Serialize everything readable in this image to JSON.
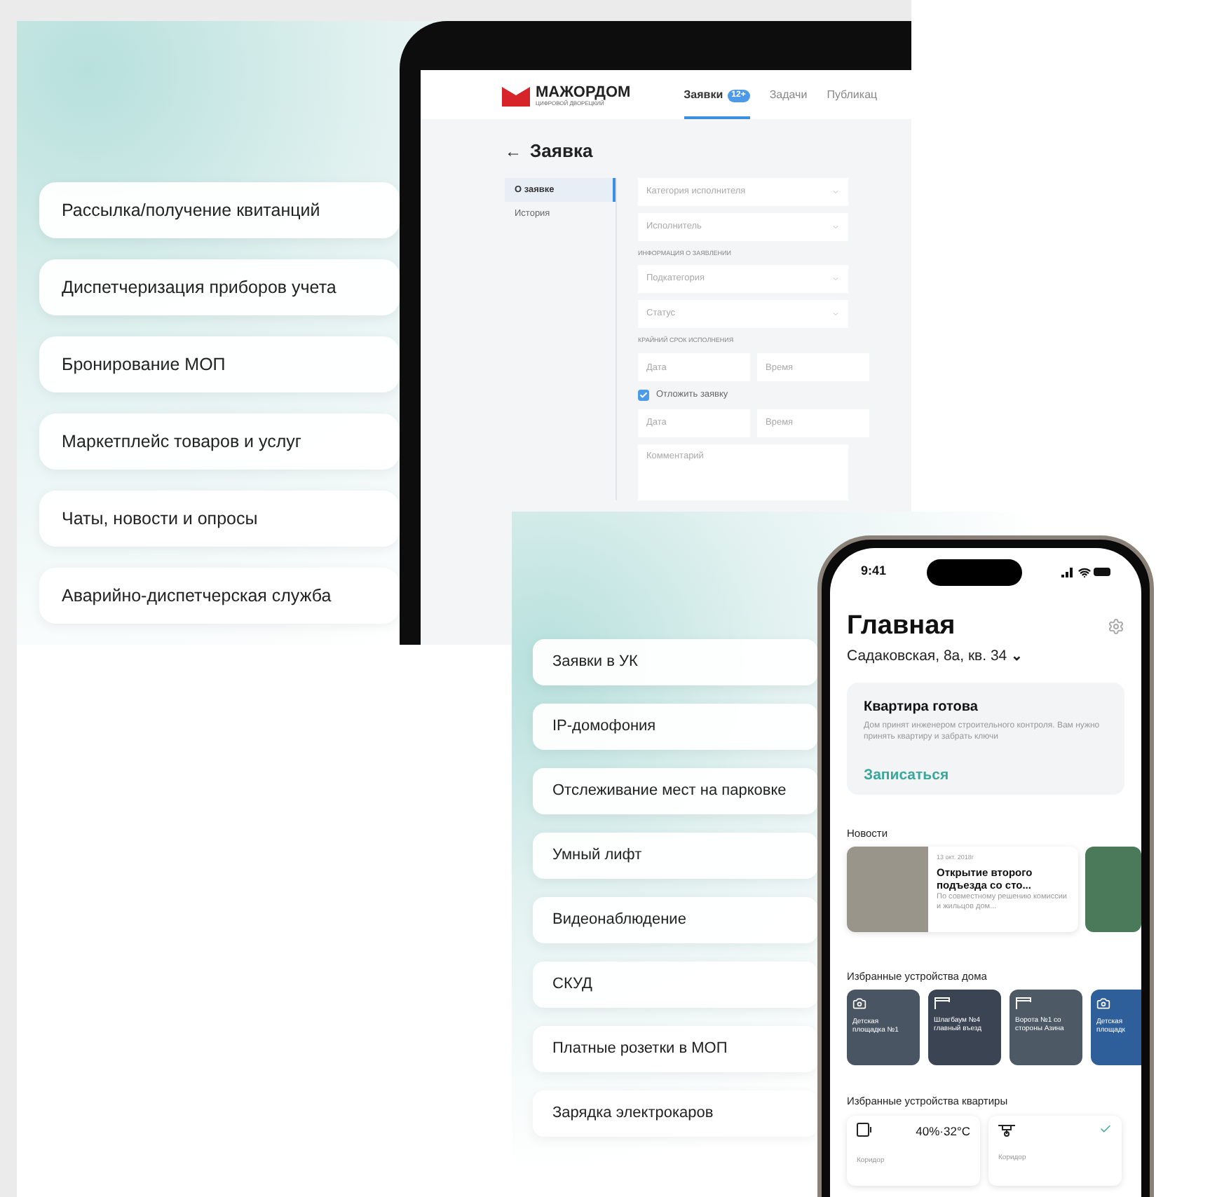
{
  "left_panel": {
    "features": [
      {
        "label": "Рассылка/получение квитанций"
      },
      {
        "label": "Диспетчеризация приборов учета"
      },
      {
        "label": "Бронирование МОП"
      },
      {
        "label": "Маркетплейс товаров и услуг"
      },
      {
        "label": "Чаты, новости и опросы"
      },
      {
        "label": "Аварийно-диспетчерская служба"
      }
    ],
    "tablet": {
      "logo": {
        "name": "МАЖОРДОМ",
        "tagline": "ЦИФРОВОЙ ДВОРЕЦКИЙ"
      },
      "tabs": [
        {
          "label": "Заявки",
          "badge": "12+",
          "selected": true
        },
        {
          "label": "Задачи",
          "selected": false
        },
        {
          "label": "Публикац",
          "selected": false
        }
      ],
      "page_title": "Заявка",
      "back_icon": "←",
      "sidebar": [
        {
          "label": "О заявке",
          "selected": true
        },
        {
          "label": "История",
          "selected": false
        }
      ],
      "form": [
        {
          "kind": "select",
          "placeholder": "Категория исполнителя"
        },
        {
          "kind": "select",
          "placeholder": "Исполнитель"
        },
        {
          "kind": "label",
          "text": "ИНФОРМАЦИЯ О ЗАЯВЛЕНИИ"
        },
        {
          "kind": "select",
          "placeholder": "Подкатегория"
        },
        {
          "kind": "select",
          "placeholder": "Статус"
        },
        {
          "kind": "label",
          "text": "КРАЙНИЙ СРОК ИСПОЛНЕНИЯ"
        },
        {
          "kind": "pair",
          "placeholders": [
            "Дата",
            "Время"
          ]
        },
        {
          "kind": "checkbox",
          "text": "Отложить заявку",
          "checked": true
        },
        {
          "kind": "pair",
          "placeholders": [
            "Дата",
            "Время"
          ]
        },
        {
          "kind": "textarea",
          "placeholder": "Комментарий"
        }
      ]
    }
  },
  "right_panel": {
    "features": [
      {
        "label": "Заявки в УК"
      },
      {
        "label": "IP-домофония"
      },
      {
        "label": "Отслеживание мест на парковке"
      },
      {
        "label": "Умный лифт"
      },
      {
        "label": "Видеонаблюдение"
      },
      {
        "label": "СКУД"
      },
      {
        "label": "Платные розетки в МОП"
      },
      {
        "label": "Зарядка электрокаров"
      }
    ],
    "phone": {
      "time": "9:41",
      "title": "Главная",
      "address": "Садаковская, 8а, кв. 34",
      "chevron": "⌄",
      "notice": {
        "title": "Квартира готова",
        "text": "Дом принят инженером строительного контроля. Вам нужно принять квартиру и забрать ключи",
        "action": "Записаться"
      },
      "news_heading": "Новости",
      "news": [
        {
          "date": "13 окт. 2018г",
          "title": "Открытие второго подъезда со сто...",
          "text": "По совместному решению комиссии и жильцов дом..."
        }
      ],
      "home_devices_heading": "Избранные устройства дома",
      "home_devices": [
        {
          "kind": "camera",
          "label": "Детская площадка №1",
          "color": "#4a5563"
        },
        {
          "kind": "barrier",
          "label": "Шлагбаум №4 главный въезд",
          "color": "#3a4452"
        },
        {
          "kind": "barrier",
          "label": "Ворота №1 со стороны Азина",
          "color": "#4d5a66"
        },
        {
          "kind": "camera",
          "label": "Детская площадк",
          "color": "#2f5f9a"
        }
      ],
      "flat_devices_heading": "Избранные устройства квартиры",
      "flat_devices": [
        {
          "kind": "sensor",
          "reading": "40%·32°C",
          "room": "Коридор",
          "checked": false
        },
        {
          "kind": "valve",
          "room": "Коридор",
          "checked": true
        }
      ]
    }
  }
}
